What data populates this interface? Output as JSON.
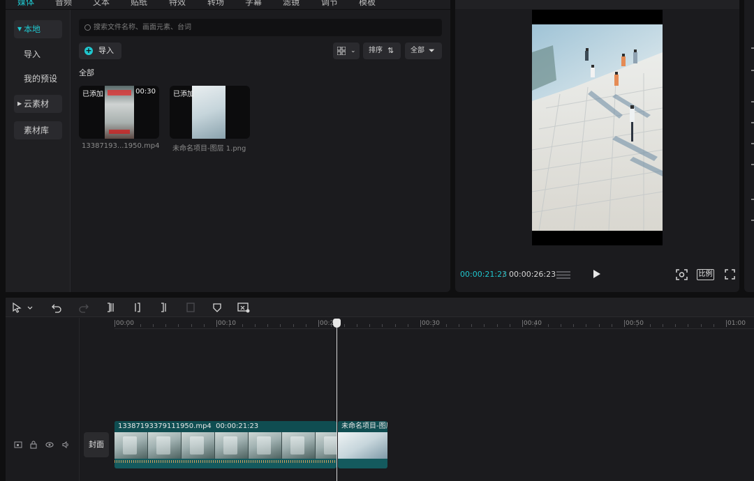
{
  "top_tabs": [
    {
      "label": "媒体",
      "active": true
    },
    {
      "label": "音频",
      "active": false
    },
    {
      "label": "文本",
      "active": false
    },
    {
      "label": "贴纸",
      "active": false
    },
    {
      "label": "特效",
      "active": false
    },
    {
      "label": "转场",
      "active": false
    },
    {
      "label": "字幕",
      "active": false
    },
    {
      "label": "滤镜",
      "active": false
    },
    {
      "label": "调节",
      "active": false
    },
    {
      "label": "模板",
      "active": false
    }
  ],
  "sidebar": {
    "items": [
      {
        "label": "本地",
        "active": true,
        "expandable": true
      },
      {
        "label": "导入",
        "active": false
      },
      {
        "label": "我的预设",
        "active": false
      },
      {
        "label": "云素材",
        "active": false,
        "expandable": true
      },
      {
        "label": "素材库",
        "active": false
      }
    ]
  },
  "search": {
    "placeholder": "搜索文件名称、画面元素、台词"
  },
  "toolbar": {
    "import_label": "导入",
    "sort_label": "排序",
    "filter_label": "全部"
  },
  "section_label": "全部",
  "media_items": [
    {
      "added_label": "已添加",
      "duration": "00:30",
      "filename": "13387193...1950.mp4"
    },
    {
      "added_label": "已添加",
      "duration": "",
      "filename": "未命名项目-图层 1.png"
    }
  ],
  "preview": {
    "current_time": "00:00:21:23",
    "separator": "/",
    "total_time": "00:00:26:23",
    "ratio_label": "比例"
  },
  "timeline": {
    "ruler_labels": [
      "00:00",
      "00:10",
      "00:20",
      "00:30",
      "00:40",
      "00:50",
      "01:00"
    ],
    "cover_label": "封面",
    "clips": [
      {
        "name": "13387193379111950.mp4",
        "duration": "00:00:21:23"
      },
      {
        "name": "未命名项目-图层"
      }
    ]
  },
  "colors": {
    "accent": "#20c7cf",
    "panel_bg": "#1b1b1e",
    "clip_bg": "#145a5e"
  },
  "icons": {
    "select_tool": "cursor-arrow-icon",
    "undo": "undo-icon",
    "redo": "redo-icon",
    "split": "split-icon",
    "delete": "delete-icon",
    "marker": "shield-marker-icon",
    "freeze": "freeze-frame-icon",
    "play": "play-icon",
    "fullscreen": "fullscreen-icon"
  }
}
